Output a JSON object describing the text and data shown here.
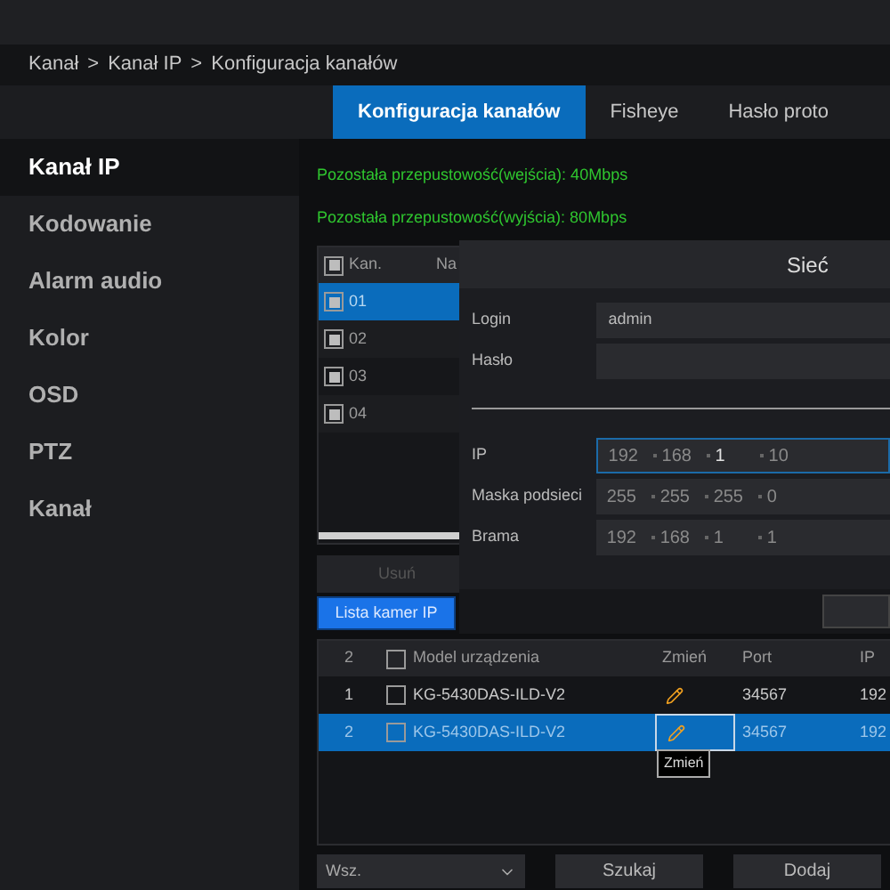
{
  "breadcrumb": [
    "Kanał",
    ">",
    "Kanał IP",
    ">",
    "Konfiguracja kanałów"
  ],
  "sidebar": {
    "items": [
      {
        "label": "Kanał IP",
        "selected": true
      },
      {
        "label": "Kodowanie",
        "selected": false
      },
      {
        "label": "Alarm audio",
        "selected": false
      },
      {
        "label": "Kolor",
        "selected": false
      },
      {
        "label": "OSD",
        "selected": false
      },
      {
        "label": "PTZ",
        "selected": false
      },
      {
        "label": "Kanał",
        "selected": false
      }
    ]
  },
  "tabs": [
    {
      "label": "Konfiguracja kanałów",
      "selected": true
    },
    {
      "label": "Fisheye",
      "selected": false
    },
    {
      "label": "Hasło proto",
      "selected": false
    }
  ],
  "bandwidth": [
    "Pozostała przepustowość(wejścia): 40Mbps",
    "Pozostała przepustowość(wyjścia): 80Mbps"
  ],
  "channel_table": {
    "header_checked": true,
    "columns": [
      "Kan.",
      "Na"
    ],
    "rows": [
      {
        "channel": "01",
        "checked": true,
        "selected": true
      },
      {
        "channel": "02",
        "checked": true,
        "selected": false
      },
      {
        "channel": "03",
        "checked": true,
        "selected": false
      },
      {
        "channel": "04",
        "checked": true,
        "selected": false
      }
    ]
  },
  "delete_button": {
    "label": "Usuń",
    "disabled": true
  },
  "camera_list_button": {
    "label": "Lista kamer IP"
  },
  "dialog": {
    "title": "Sieć",
    "login_label": "Login",
    "login_value": "admin",
    "password_label": "Hasło",
    "ip_label": "IP",
    "ip": [
      "192",
      "168",
      "1",
      "10"
    ],
    "mask_label": "Maska podsieci",
    "mask": [
      "255",
      "255",
      "255",
      "0"
    ],
    "gateway_label": "Brama",
    "gateway": [
      "192",
      "168",
      "1",
      "1"
    ]
  },
  "device_table": {
    "header_checked": false,
    "columns": [
      "2",
      "Model urządzenia",
      "Zmień",
      "Port",
      "IP"
    ],
    "rows": [
      {
        "number": "1",
        "checked": false,
        "model": "KG-5430DAS-ILD-V2",
        "port": "34567",
        "ip": "192",
        "selected": false
      },
      {
        "number": "2",
        "checked": false,
        "model": "KG-5430DAS-ILD-V2",
        "port": "34567",
        "ip": "192",
        "selected": true
      }
    ]
  },
  "tooltip": "Zmień",
  "filter": {
    "value": "Wsz."
  },
  "search_button": "Szukaj",
  "add_button": "Dodaj"
}
